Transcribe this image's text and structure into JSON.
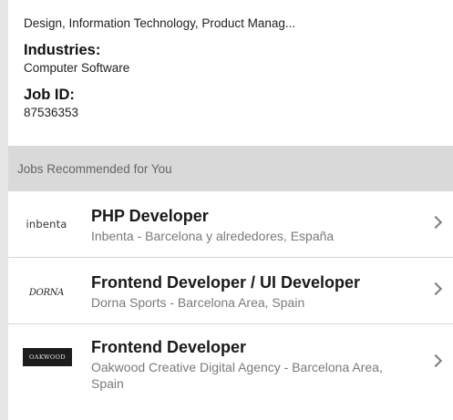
{
  "job_details": {
    "functions_value": "Design, Information Technology, Product Manag...",
    "industries_label": "Industries:",
    "industries_value": "Computer Software",
    "job_id_label": "Job ID:",
    "job_id_value": "87536353"
  },
  "recommended": {
    "header": "Jobs Recommended for You",
    "jobs": [
      {
        "logo_text": "inbenta",
        "logo_icon": "inbenta-logo",
        "title": "PHP Developer",
        "subtitle": "Inbenta - Barcelona y alrededores, España"
      },
      {
        "logo_text": "DORNA",
        "logo_icon": "dorna-logo",
        "title": "Frontend Developer / UI Developer",
        "subtitle": "Dorna Sports - Barcelona Area, Spain"
      },
      {
        "logo_text": "OAKWOOD",
        "logo_icon": "oakwood-logo",
        "title": "Frontend Developer",
        "subtitle": "Oakwood Creative Digital Agency - Barcelona Area, Spain"
      }
    ]
  },
  "colors": {
    "background": "#e6e6e6",
    "section_header_bg": "#d9d9d9",
    "subtitle_text": "#7a7a7a",
    "chevron": "#7d7d7d"
  }
}
